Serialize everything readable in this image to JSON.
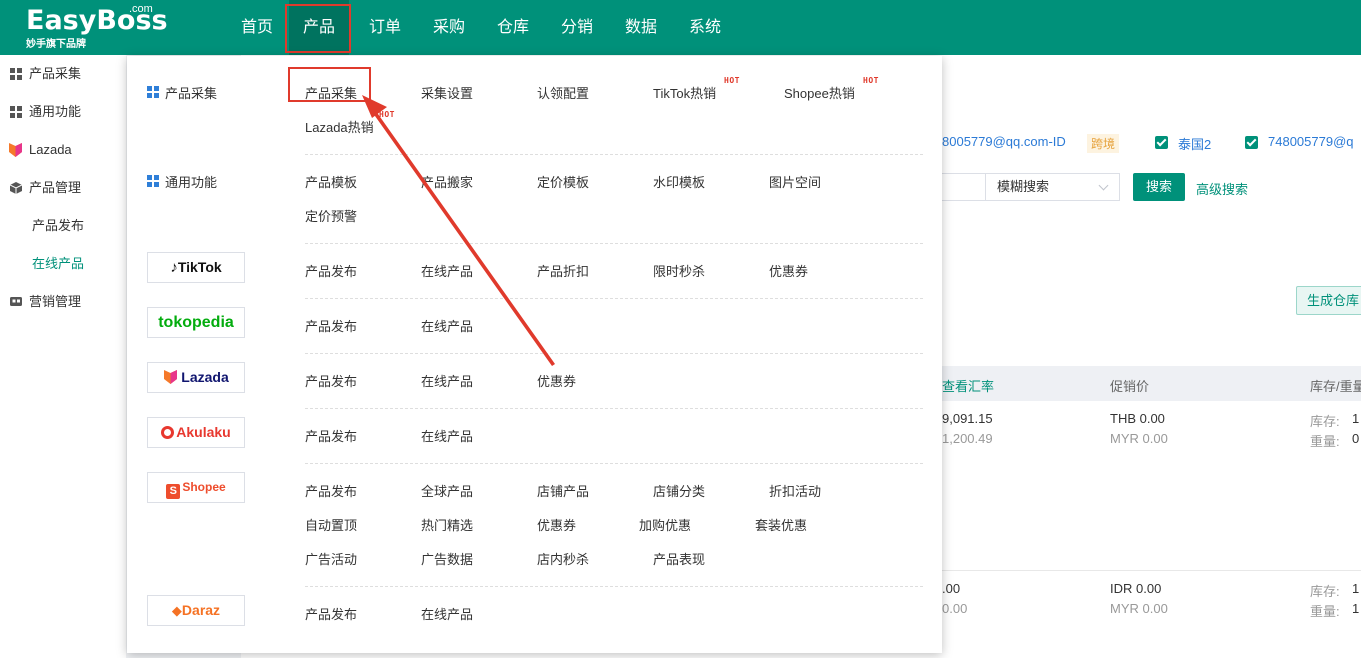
{
  "header": {
    "logo_name": "EasyBoss",
    "logo_com": ".com",
    "logo_tagline": "妙手旗下品牌",
    "nav": [
      "首页",
      "产品",
      "订单",
      "采购",
      "仓库",
      "分销",
      "数据",
      "系统"
    ],
    "active_nav": "产品"
  },
  "sidebar": {
    "items": [
      {
        "label": "产品采集",
        "icon": "grid-icon"
      },
      {
        "label": "通用功能",
        "icon": "grid-icon"
      },
      {
        "label": "Lazada",
        "icon": "lazada-icon"
      },
      {
        "label": "产品管理",
        "icon": "box-icon"
      },
      {
        "label": "营销管理",
        "icon": "ad-icon"
      }
    ],
    "sub_items": [
      "产品发布",
      "在线产品"
    ],
    "active_sub": "在线产品"
  },
  "background": {
    "account1": "8005779@qq.com-ID",
    "cross_badge": "跨境",
    "shop2": "泰国2",
    "account2": "748005779@q",
    "search_mode": "模糊搜索",
    "search_btn": "搜索",
    "advanced": "高级搜索",
    "generate_btn": "生成仓库",
    "col_rate": "查看汇率",
    "col_promo": "促销价",
    "col_stock": "库存/重量",
    "rows": [
      {
        "price1": "9,091.15",
        "price2": "1,200.49",
        "promo1": "THB 0.00",
        "promo2": "MYR 0.00",
        "stock_label": "库存:",
        "stock": "1",
        "weight_label": "重量:",
        "weight": "0"
      },
      {
        "price1": ".00",
        "price2": "0.00",
        "promo1": "IDR 0.00",
        "promo2": "MYR 0.00",
        "stock_label": "库存:",
        "stock": "1",
        "weight_label": "重量:",
        "weight": "1"
      }
    ]
  },
  "menu": {
    "collect": {
      "title": "产品采集",
      "items": [
        "产品采集",
        "采集设置",
        "认领配置",
        "TikTok热销",
        "Shopee热销",
        "Lazada热销"
      ]
    },
    "general": {
      "title": "通用功能",
      "items": [
        "产品模板",
        "产品搬家",
        "定价模板",
        "水印模板",
        "图片空间",
        "定价预警"
      ]
    },
    "tiktok": {
      "logo": "TikTok",
      "items": [
        "产品发布",
        "在线产品",
        "产品折扣",
        "限时秒杀",
        "优惠券"
      ]
    },
    "tokopedia": {
      "logo": "tokopedia",
      "items": [
        "产品发布",
        "在线产品"
      ]
    },
    "lazada": {
      "logo": "Lazada",
      "items": [
        "产品发布",
        "在线产品",
        "优惠券"
      ]
    },
    "akulaku": {
      "logo": "Akulaku",
      "items": [
        "产品发布",
        "在线产品"
      ]
    },
    "shopee": {
      "logo": "Shopee",
      "items": [
        "产品发布",
        "全球产品",
        "店铺产品",
        "店铺分类",
        "折扣活动",
        "自动置顶",
        "热门精选",
        "优惠券",
        "加购优惠",
        "套装优惠",
        "广告活动",
        "广告数据",
        "店内秒杀",
        "产品表现"
      ]
    },
    "daraz": {
      "logo": "Daraz",
      "items": [
        "产品发布",
        "在线产品"
      ]
    },
    "hot_label": "HOT"
  },
  "colors": {
    "brand": "#00917a",
    "annotation": "#e03a2c"
  }
}
